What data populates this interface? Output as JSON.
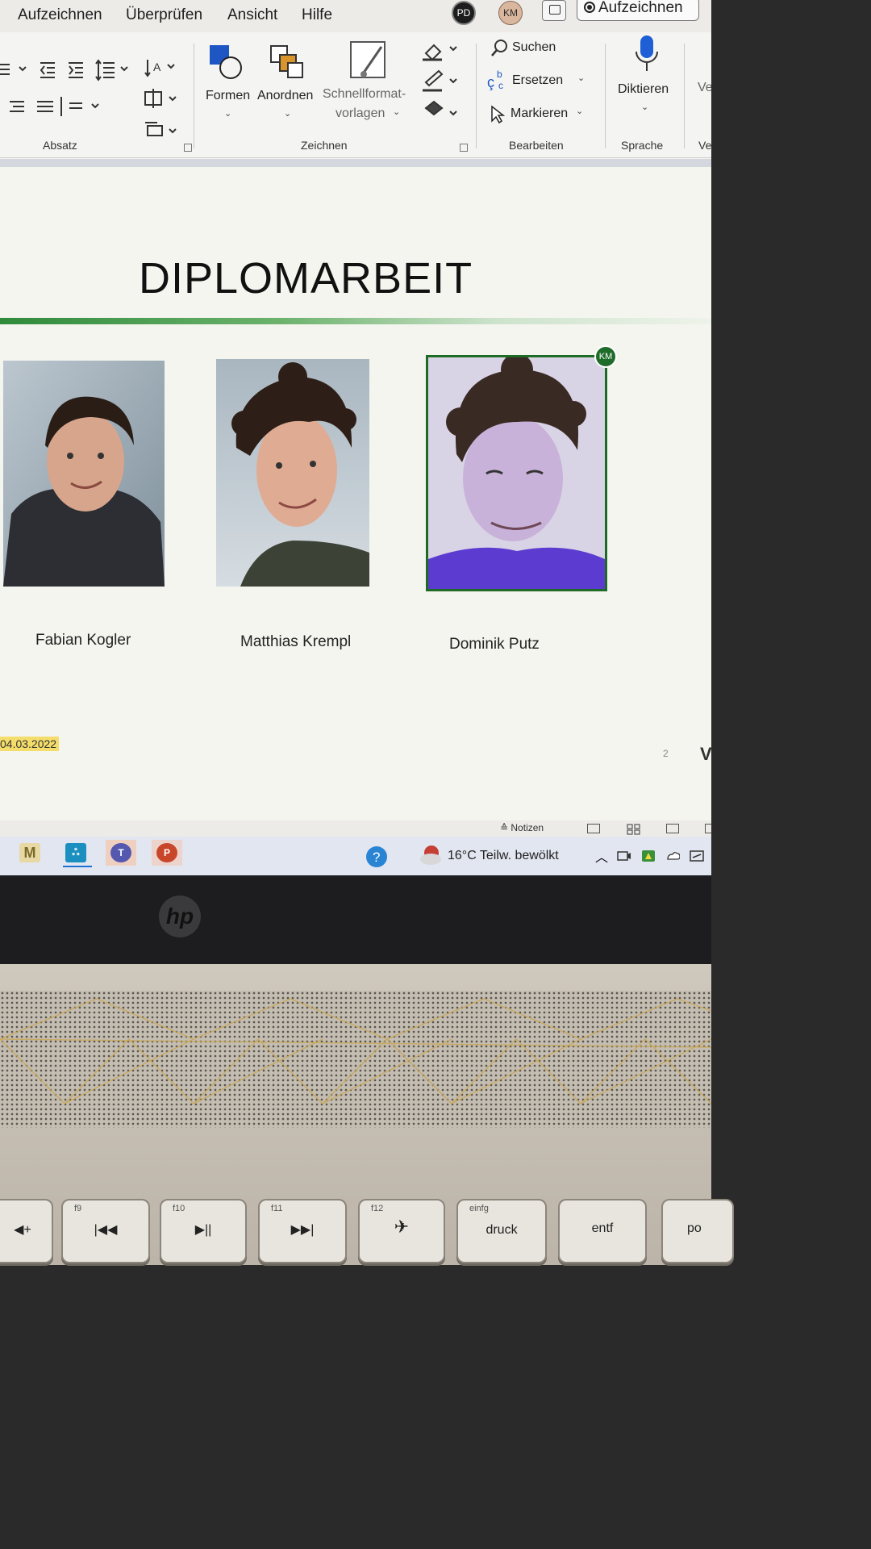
{
  "menu": {
    "items": [
      "Aufzeichnen",
      "Überprüfen",
      "Ansicht",
      "Hilfe"
    ],
    "avatar_pd": "PD",
    "avatar_km": "KM",
    "record_label": "Aufzeichnen"
  },
  "ribbon": {
    "groups": {
      "absatz": "Absatz",
      "zeichnen": "Zeichnen",
      "bearbeiten": "Bearbeiten",
      "sprache": "Sprache",
      "cut_label": "Ve"
    },
    "formen": "Formen",
    "anordnen": "Anordnen",
    "schnellformat_1": "Schnellformat-",
    "schnellformat_2": "vorlagen",
    "suchen": "Suchen",
    "ersetzen": "Ersetzen",
    "markieren": "Markieren",
    "diktieren": "Diktieren",
    "cut_button": "Ve"
  },
  "slide": {
    "title": "DIPLOMARBEIT",
    "people": [
      {
        "name": "Fabian Kogler"
      },
      {
        "name": "Matthias Krempl"
      },
      {
        "name": "Dominik Putz"
      }
    ],
    "presence_badge": "KM",
    "date": "04.03.2022",
    "page_number": "2",
    "logo_fragment": "V"
  },
  "statusbar": {
    "notes": "Notizen"
  },
  "taskbar": {
    "weather": "16°C  Teilw. bewölkt",
    "apps": [
      "M",
      "ஃ",
      "T",
      "P"
    ]
  },
  "device": {
    "brand": "hp"
  },
  "keyboard": {
    "keys": [
      {
        "fn": "",
        "cap": "◀+"
      },
      {
        "fn": "f9",
        "cap": "|◀◀"
      },
      {
        "fn": "f10",
        "cap": "▶||"
      },
      {
        "fn": "f11",
        "cap": "▶▶|"
      },
      {
        "fn": "f12",
        "cap": "✈"
      },
      {
        "fn": "einfg",
        "cap": "druck"
      },
      {
        "fn": "",
        "cap": "entf"
      },
      {
        "fn": "",
        "cap": "po"
      }
    ]
  }
}
